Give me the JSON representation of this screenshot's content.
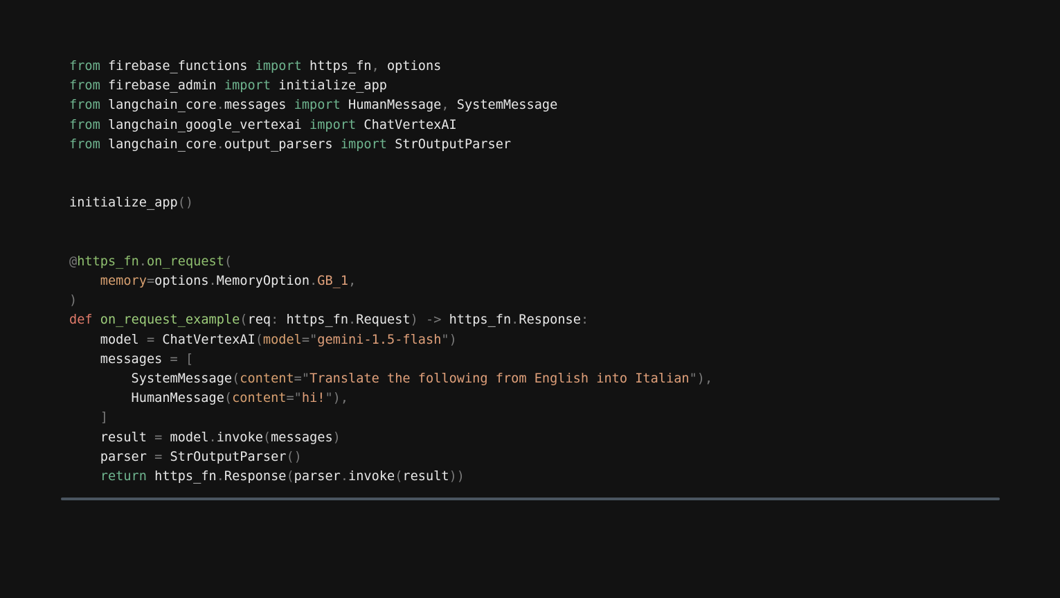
{
  "theme": {
    "background": "#121212",
    "text": "#e8e8e8",
    "keyword": "#6fb58f",
    "def_keyword": "#e07a6a",
    "function": "#9ccc7a",
    "string": "#e0a07a",
    "punctuation": "#7a7a7a",
    "scrollbar": "#4a5560"
  },
  "code": {
    "language": "python",
    "lines": [
      [
        [
          "kw",
          "from"
        ],
        [
          "id",
          " firebase_functions "
        ],
        [
          "kw",
          "import"
        ],
        [
          "id",
          " https_fn"
        ],
        [
          "punc",
          ","
        ],
        [
          "id",
          " options"
        ]
      ],
      [
        [
          "kw",
          "from"
        ],
        [
          "id",
          " firebase_admin "
        ],
        [
          "kw",
          "import"
        ],
        [
          "id",
          " initialize_app"
        ]
      ],
      [
        [
          "kw",
          "from"
        ],
        [
          "id",
          " langchain_core"
        ],
        [
          "punc",
          "."
        ],
        [
          "id",
          "messages "
        ],
        [
          "kw",
          "import"
        ],
        [
          "id",
          " HumanMessage"
        ],
        [
          "punc",
          ","
        ],
        [
          "id",
          " SystemMessage"
        ]
      ],
      [
        [
          "kw",
          "from"
        ],
        [
          "id",
          " langchain_google_vertexai "
        ],
        [
          "kw",
          "import"
        ],
        [
          "id",
          " ChatVertexAI"
        ]
      ],
      [
        [
          "kw",
          "from"
        ],
        [
          "id",
          " langchain_core"
        ],
        [
          "punc",
          "."
        ],
        [
          "id",
          "output_parsers "
        ],
        [
          "kw",
          "import"
        ],
        [
          "id",
          " StrOutputParser"
        ]
      ],
      [],
      [],
      [
        [
          "id",
          "initialize_app"
        ],
        [
          "punc",
          "()"
        ]
      ],
      [],
      [],
      [
        [
          "punc",
          "@"
        ],
        [
          "dec",
          "https_fn"
        ],
        [
          "punc",
          "."
        ],
        [
          "dec",
          "on_request"
        ],
        [
          "punc",
          "("
        ]
      ],
      [
        [
          "id",
          "    "
        ],
        [
          "arg",
          "memory"
        ],
        [
          "punc",
          "="
        ],
        [
          "id",
          "options"
        ],
        [
          "punc",
          "."
        ],
        [
          "id",
          "MemoryOption"
        ],
        [
          "punc",
          "."
        ],
        [
          "const",
          "GB_1"
        ],
        [
          "punc",
          ","
        ]
      ],
      [
        [
          "punc",
          ")"
        ]
      ],
      [
        [
          "def",
          "def"
        ],
        [
          "id",
          " "
        ],
        [
          "fn",
          "on_request_example"
        ],
        [
          "punc",
          "("
        ],
        [
          "id",
          "req"
        ],
        [
          "punc",
          ":"
        ],
        [
          "id",
          " https_fn"
        ],
        [
          "punc",
          "."
        ],
        [
          "id",
          "Request"
        ],
        [
          "punc",
          ")"
        ],
        [
          "id",
          " "
        ],
        [
          "punc",
          "->"
        ],
        [
          "id",
          " https_fn"
        ],
        [
          "punc",
          "."
        ],
        [
          "id",
          "Response"
        ],
        [
          "punc",
          ":"
        ]
      ],
      [
        [
          "id",
          "    model "
        ],
        [
          "punc",
          "="
        ],
        [
          "id",
          " ChatVertexAI"
        ],
        [
          "punc",
          "("
        ],
        [
          "arg",
          "model"
        ],
        [
          "punc",
          "="
        ],
        [
          "punc",
          "\""
        ],
        [
          "str",
          "gemini-1.5-flash"
        ],
        [
          "punc",
          "\")"
        ]
      ],
      [
        [
          "id",
          "    messages "
        ],
        [
          "punc",
          "="
        ],
        [
          "id",
          " "
        ],
        [
          "punc",
          "["
        ]
      ],
      [
        [
          "id",
          "        SystemMessage"
        ],
        [
          "punc",
          "("
        ],
        [
          "arg",
          "content"
        ],
        [
          "punc",
          "="
        ],
        [
          "punc",
          "\""
        ],
        [
          "str",
          "Translate the following from English into Italian"
        ],
        [
          "punc",
          "\"),"
        ]
      ],
      [
        [
          "id",
          "        HumanMessage"
        ],
        [
          "punc",
          "("
        ],
        [
          "arg",
          "content"
        ],
        [
          "punc",
          "="
        ],
        [
          "punc",
          "\""
        ],
        [
          "str",
          "hi!"
        ],
        [
          "punc",
          "\"),"
        ]
      ],
      [
        [
          "id",
          "    "
        ],
        [
          "punc",
          "]"
        ]
      ],
      [
        [
          "id",
          "    result "
        ],
        [
          "punc",
          "="
        ],
        [
          "id",
          " model"
        ],
        [
          "punc",
          "."
        ],
        [
          "id",
          "invoke"
        ],
        [
          "punc",
          "("
        ],
        [
          "id",
          "messages"
        ],
        [
          "punc",
          ")"
        ]
      ],
      [
        [
          "id",
          "    parser "
        ],
        [
          "punc",
          "="
        ],
        [
          "id",
          " StrOutputParser"
        ],
        [
          "punc",
          "()"
        ]
      ],
      [
        [
          "id",
          "    "
        ],
        [
          "kw",
          "return"
        ],
        [
          "id",
          " https_fn"
        ],
        [
          "punc",
          "."
        ],
        [
          "id",
          "Response"
        ],
        [
          "punc",
          "("
        ],
        [
          "id",
          "parser"
        ],
        [
          "punc",
          "."
        ],
        [
          "id",
          "invoke"
        ],
        [
          "punc",
          "("
        ],
        [
          "id",
          "result"
        ],
        [
          "punc",
          "))"
        ]
      ]
    ]
  }
}
